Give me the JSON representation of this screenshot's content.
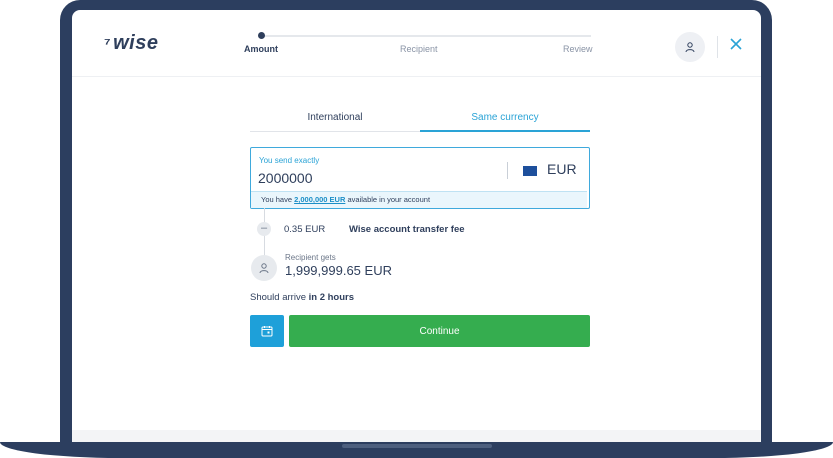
{
  "header": {
    "logo_text": "wise",
    "logo_flag": "⁷",
    "steps": [
      {
        "label": "Amount",
        "active": true
      },
      {
        "label": "Recipient",
        "active": false
      },
      {
        "label": "Review",
        "active": false
      }
    ]
  },
  "tabs": [
    {
      "label": "International",
      "active": false
    },
    {
      "label": "Same currency",
      "active": true
    }
  ],
  "send": {
    "label": "You send exactly",
    "value": "2000000",
    "currency": "EUR",
    "available_prefix": "You have ",
    "available_amount": "2,000,000 EUR",
    "available_suffix": " available in your account"
  },
  "breakdown": {
    "fee_sign": "–",
    "fee_amount": "0.35 EUR",
    "fee_label": "Wise account transfer fee",
    "recipient_label": "Recipient gets",
    "recipient_amount": "1,999,999.65 EUR"
  },
  "arrival": {
    "prefix": "Should arrive ",
    "time": "in 2 hours"
  },
  "actions": {
    "continue_label": "Continue"
  },
  "colors": {
    "frame": "#2c3e5f",
    "accent_blue": "#2aa3d6",
    "continue_green": "#35ad4f",
    "text_dark": "#2f3f5c"
  },
  "icons": {
    "avatar": "person-icon",
    "close": "close-icon",
    "calendar": "calendar-icon",
    "currency_flag": "eu-flag-icon"
  }
}
